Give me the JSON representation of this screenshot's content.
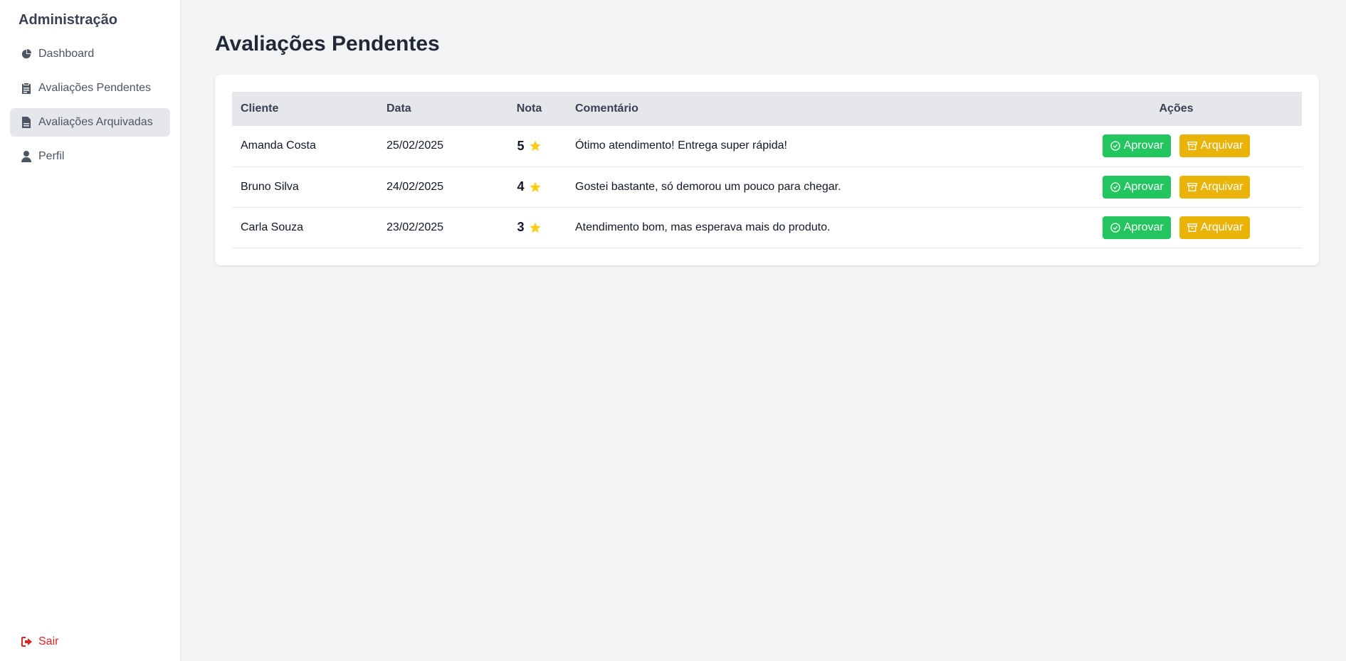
{
  "sidebar": {
    "title": "Administração",
    "items": [
      {
        "label": "Dashboard",
        "icon": "chart-pie-icon",
        "active": false
      },
      {
        "label": "Avaliações Pendentes",
        "icon": "clipboard-icon",
        "active": false
      },
      {
        "label": "Avaliações Arquivadas",
        "icon": "file-icon",
        "active": true
      },
      {
        "label": "Perfil",
        "icon": "user-icon",
        "active": false
      }
    ],
    "logout_label": "Sair"
  },
  "main": {
    "title": "Avaliações Pendentes",
    "table": {
      "headers": {
        "client": "Cliente",
        "date": "Data",
        "rating": "Nota",
        "comment": "Comentário",
        "actions": "Ações"
      },
      "rows": [
        {
          "client": "Amanda Costa",
          "date": "25/02/2025",
          "rating": "5",
          "comment": "Ótimo atendimento! Entrega super rápida!"
        },
        {
          "client": "Bruno Silva",
          "date": "24/02/2025",
          "rating": "4",
          "comment": "Gostei bastante, só demorou um pouco para chegar."
        },
        {
          "client": "Carla Souza",
          "date": "23/02/2025",
          "rating": "3",
          "comment": "Atendimento bom, mas esperava mais do produto."
        }
      ],
      "approve_label": "Aprovar",
      "archive_label": "Arquivar"
    }
  },
  "colors": {
    "approve": "#22c55e",
    "archive": "#eab308",
    "logout": "#dc2626",
    "star": "#facc15"
  }
}
